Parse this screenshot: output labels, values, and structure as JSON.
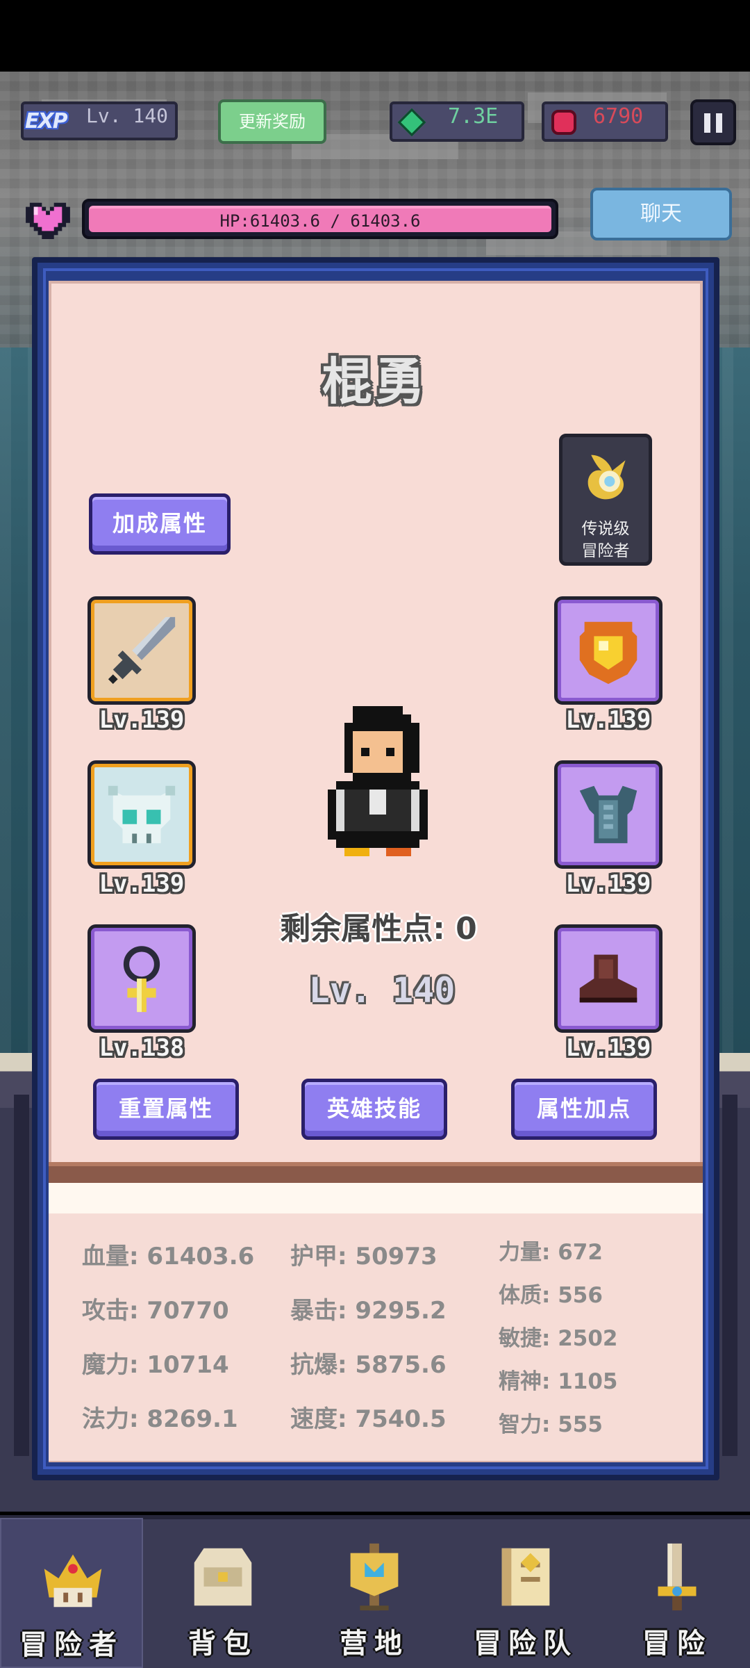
{
  "hud": {
    "exp_badge": "EXP",
    "level": "Lv. 140",
    "refresh_label": "更新奖励",
    "green_gems": "7.3E",
    "red_gems": "6790",
    "hp_text": "HP:61403.6 / 61403.6",
    "chat_label": "聊天"
  },
  "hero": {
    "name": "棍勇",
    "bonus_button": "加成属性",
    "badge_line1": "传说级",
    "badge_line2": "冒险者",
    "points": "剩余属性点: 0",
    "level": "Lv. 140"
  },
  "equipment": {
    "weapon_level": "Lv.139",
    "helmet_level": "Lv.139",
    "necklace_level": "Lv.138",
    "shield_level": "Lv.139",
    "armor_level": "Lv.139",
    "boots_level": "Lv.139",
    "icons": [
      "sword-icon",
      "skull-helmet-icon",
      "cross-necklace-icon",
      "shield-icon",
      "armor-icon",
      "boots-icon"
    ]
  },
  "actions": {
    "reset": "重置属性",
    "skills": "英雄技能",
    "allocate": "属性加点"
  },
  "stats": {
    "hp": "血量: 61403.6",
    "attack": "攻击: 70770",
    "magic": "魔力: 10714",
    "mana": "法力: 8269.1",
    "armor": "护甲: 50973",
    "crit": "暴击: 9295.2",
    "crit_resist": "抗爆: 5875.6",
    "speed": "速度: 7540.5",
    "strength": "力量: 672",
    "constitution": "体质: 556",
    "agility": "敏捷: 2502",
    "spirit": "精神: 1105",
    "intellect": "智力: 555"
  },
  "nav": {
    "adventurer": "冒险者",
    "backpack": "背包",
    "camp": "营地",
    "party": "冒险队",
    "adventure": "冒险"
  },
  "colors": {
    "panel_bg": "#f8dcd6",
    "frame_blue": "#263d86",
    "button_purple": "#8f7ef0",
    "hp_pink": "#f07ab8",
    "chat_blue": "#7ab6e0",
    "refresh_green": "#7ccf8c"
  }
}
